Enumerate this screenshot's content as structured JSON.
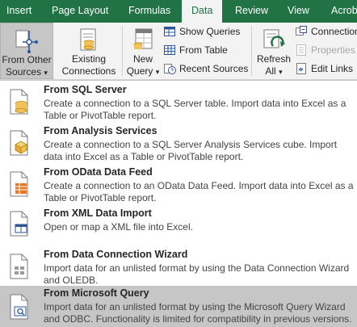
{
  "tabs": [
    "Insert",
    "Page Layout",
    "Formulas",
    "Data",
    "Review",
    "View",
    "Acrob"
  ],
  "ribbon": {
    "from_other_sources": {
      "line1": "From Other",
      "line2": "Sources",
      "arrow": "▾"
    },
    "existing_connections": {
      "line1": "Existing",
      "line2": "Connections"
    },
    "new_query": {
      "line1": "New",
      "line2": "Query",
      "arrow": "▾"
    },
    "show_queries": "Show Queries",
    "from_table": "From Table",
    "recent_sources": "Recent Sources",
    "refresh_all": {
      "line1": "Refresh",
      "line2": "All",
      "arrow": "▾"
    },
    "connections": "Connection",
    "properties": "Properties",
    "edit_links": "Edit Links"
  },
  "menu": {
    "items": [
      {
        "title": "From SQL Server",
        "description": "Create a connection to a SQL Server table. Import data into Excel as a Table or PivotTable report.",
        "icon": "sql-server-icon"
      },
      {
        "title": "From Analysis Services",
        "description": "Create a connection to a SQL Server Analysis Services cube. Import data into Excel as a Table or PivotTable report.",
        "icon": "analysis-services-icon"
      },
      {
        "title": "From OData Data Feed",
        "description": "Create a connection to an OData Data Feed. Import data into Excel as a Table or PivotTable report.",
        "icon": "odata-feed-icon"
      },
      {
        "title": "From XML Data Import",
        "description": "Open or map a XML file into Excel.",
        "icon": "xml-import-icon"
      },
      {
        "title": "From Data Connection Wizard",
        "description": "Import data for an unlisted format by using the Data Connection Wizard and OLEDB.",
        "icon": "connection-wizard-icon"
      },
      {
        "title": "From Microsoft Query",
        "description": "Import data for an unlisted format by using the Microsoft Query Wizard and ODBC. Functionality is limited for compatibility in previous versions.",
        "icon": "microsoft-query-icon"
      }
    ]
  },
  "colors": {
    "accent": "#217346",
    "ribbon_bg": "#f3f3f3",
    "highlight": "#c6c6c6"
  }
}
